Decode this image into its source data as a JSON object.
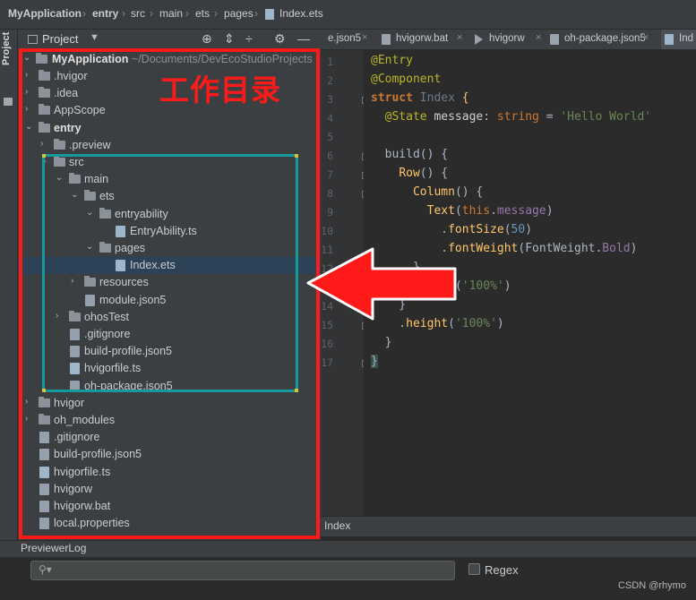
{
  "breadcrumb": {
    "items": [
      "MyApplication",
      "entry",
      "src",
      "main",
      "ets",
      "pages",
      "Index.ets"
    ]
  },
  "tool_strip": {
    "label": "Project"
  },
  "project_panel": {
    "title": "Project",
    "root_name": "MyApplication",
    "root_path": "~/Documents/DevEcoStudioProjects",
    "tree": [
      {
        "label": ".hvigor",
        "kind": "folder",
        "arrow": "›"
      },
      {
        "label": ".idea",
        "kind": "folder",
        "arrow": "›"
      },
      {
        "label": "AppScope",
        "kind": "folder",
        "arrow": "›"
      },
      {
        "label": "entry",
        "kind": "folder",
        "arrow": "⌄",
        "bold": true
      },
      {
        "label": ".preview",
        "kind": "folder",
        "arrow": "›"
      },
      {
        "label": "src",
        "kind": "folder",
        "arrow": "⌄"
      },
      {
        "label": "main",
        "kind": "folder",
        "arrow": "⌄"
      },
      {
        "label": "ets",
        "kind": "folder",
        "arrow": "⌄"
      },
      {
        "label": "entryability",
        "kind": "folder",
        "arrow": "⌄"
      },
      {
        "label": "EntryAbility.ts",
        "kind": "file"
      },
      {
        "label": "pages",
        "kind": "folder",
        "arrow": "⌄"
      },
      {
        "label": "Index.ets",
        "kind": "file",
        "selected": true
      },
      {
        "label": "resources",
        "kind": "folder",
        "arrow": "›"
      },
      {
        "label": "module.json5",
        "kind": "file"
      },
      {
        "label": "ohosTest",
        "kind": "folder",
        "arrow": "›"
      },
      {
        "label": ".gitignore",
        "kind": "file"
      },
      {
        "label": "build-profile.json5",
        "kind": "file"
      },
      {
        "label": "hvigorfile.ts",
        "kind": "file"
      },
      {
        "label": "oh-package.json5",
        "kind": "file"
      },
      {
        "label": "hvigor",
        "kind": "folder",
        "arrow": "›"
      },
      {
        "label": "oh_modules",
        "kind": "folder",
        "arrow": "›"
      },
      {
        "label": ".gitignore",
        "kind": "file"
      },
      {
        "label": "build-profile.json5",
        "kind": "file"
      },
      {
        "label": "hvigorfile.ts",
        "kind": "file"
      },
      {
        "label": "hvigorw",
        "kind": "file"
      },
      {
        "label": "hvigorw.bat",
        "kind": "file"
      },
      {
        "label": "local.properties",
        "kind": "file"
      }
    ]
  },
  "editor": {
    "tabs": [
      "e.json5",
      "hvigorw.bat",
      "hvigorw",
      "oh-package.json5",
      "Ind"
    ],
    "line_numbers": [
      "1",
      "2",
      "3",
      "4",
      "5",
      "6",
      "7",
      "8",
      "9",
      "10",
      "11",
      "12",
      "13",
      "14",
      "15",
      "16",
      "17"
    ],
    "bottom_breadcrumb": "Index"
  },
  "annotations": {
    "work_dir_label": "工作目录"
  },
  "previewer": {
    "title": "PreviewerLog",
    "search_placeholder": "",
    "regex_label": "Regex"
  },
  "watermark": "CSDN @rhymo",
  "colors": {
    "annotation_red": "#ff1a1a",
    "annotation_teal": "#159a9c",
    "selection": "#2d4256"
  }
}
